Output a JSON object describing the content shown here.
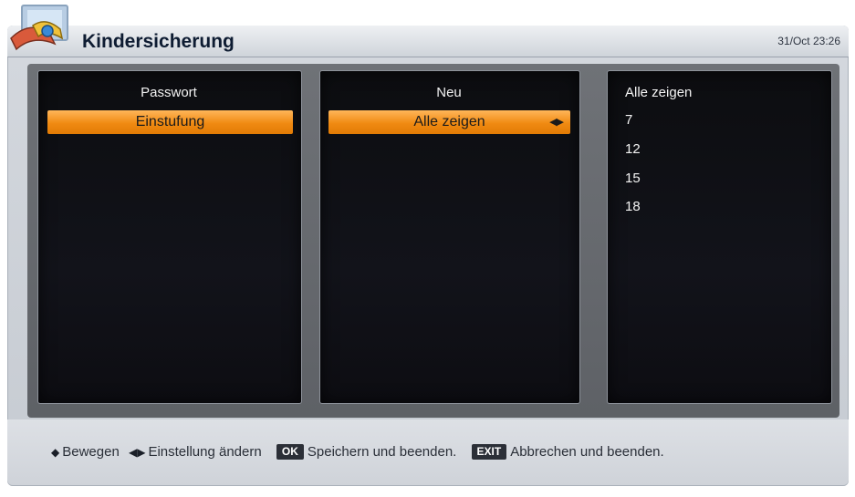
{
  "header": {
    "title": "Kindersicherung",
    "datetime": "31/Oct 23:26"
  },
  "menu": {
    "header": "Passwort",
    "selected_item": "Einstufung"
  },
  "value": {
    "header": "Neu",
    "selected_value": "Alle zeigen"
  },
  "options": [
    "Alle zeigen",
    "7",
    "12",
    "15",
    "18"
  ],
  "footer": {
    "move": "Bewegen",
    "change": "Einstellung ändern",
    "ok_key": "OK",
    "ok_text": "Speichern und beenden.",
    "exit_key": "EXIT",
    "exit_text": "Abbrechen und beenden."
  },
  "colors": {
    "highlight": "#f08a12",
    "panel": "#0d0e13",
    "frame": "#cfd4da"
  }
}
